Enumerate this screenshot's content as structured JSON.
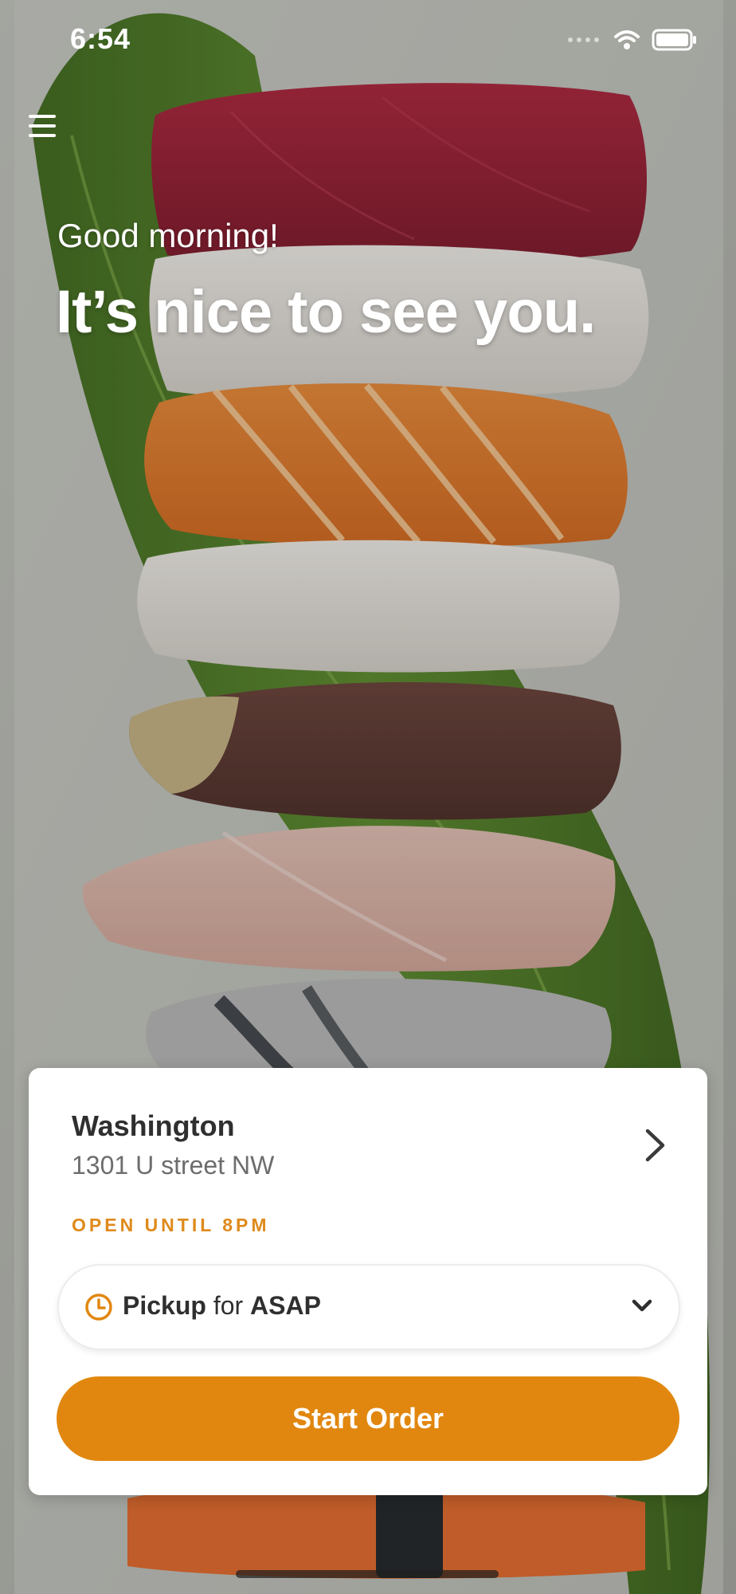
{
  "status_bar": {
    "time": "6:54",
    "icons": [
      "signal-icon",
      "wifi-icon",
      "battery-icon"
    ]
  },
  "menu": {
    "icon": "hamburger-menu-icon"
  },
  "greeting": {
    "small": "Good morning!",
    "large": "It’s nice to see you."
  },
  "location": {
    "name": "Washington",
    "address": "1301 U street NW",
    "hours": "OPEN UNTIL 8PM"
  },
  "order_mode": {
    "method": "Pickup",
    "connector": "for",
    "time": "ASAP"
  },
  "actions": {
    "start_order": "Start Order"
  },
  "colors": {
    "accent": "#E1870F",
    "card_background": "#FFFFFF",
    "primary_text": "#2F2F2F",
    "secondary_text": "#6D6D6D"
  },
  "background": {
    "image_subject": "sushi-platter-image"
  }
}
